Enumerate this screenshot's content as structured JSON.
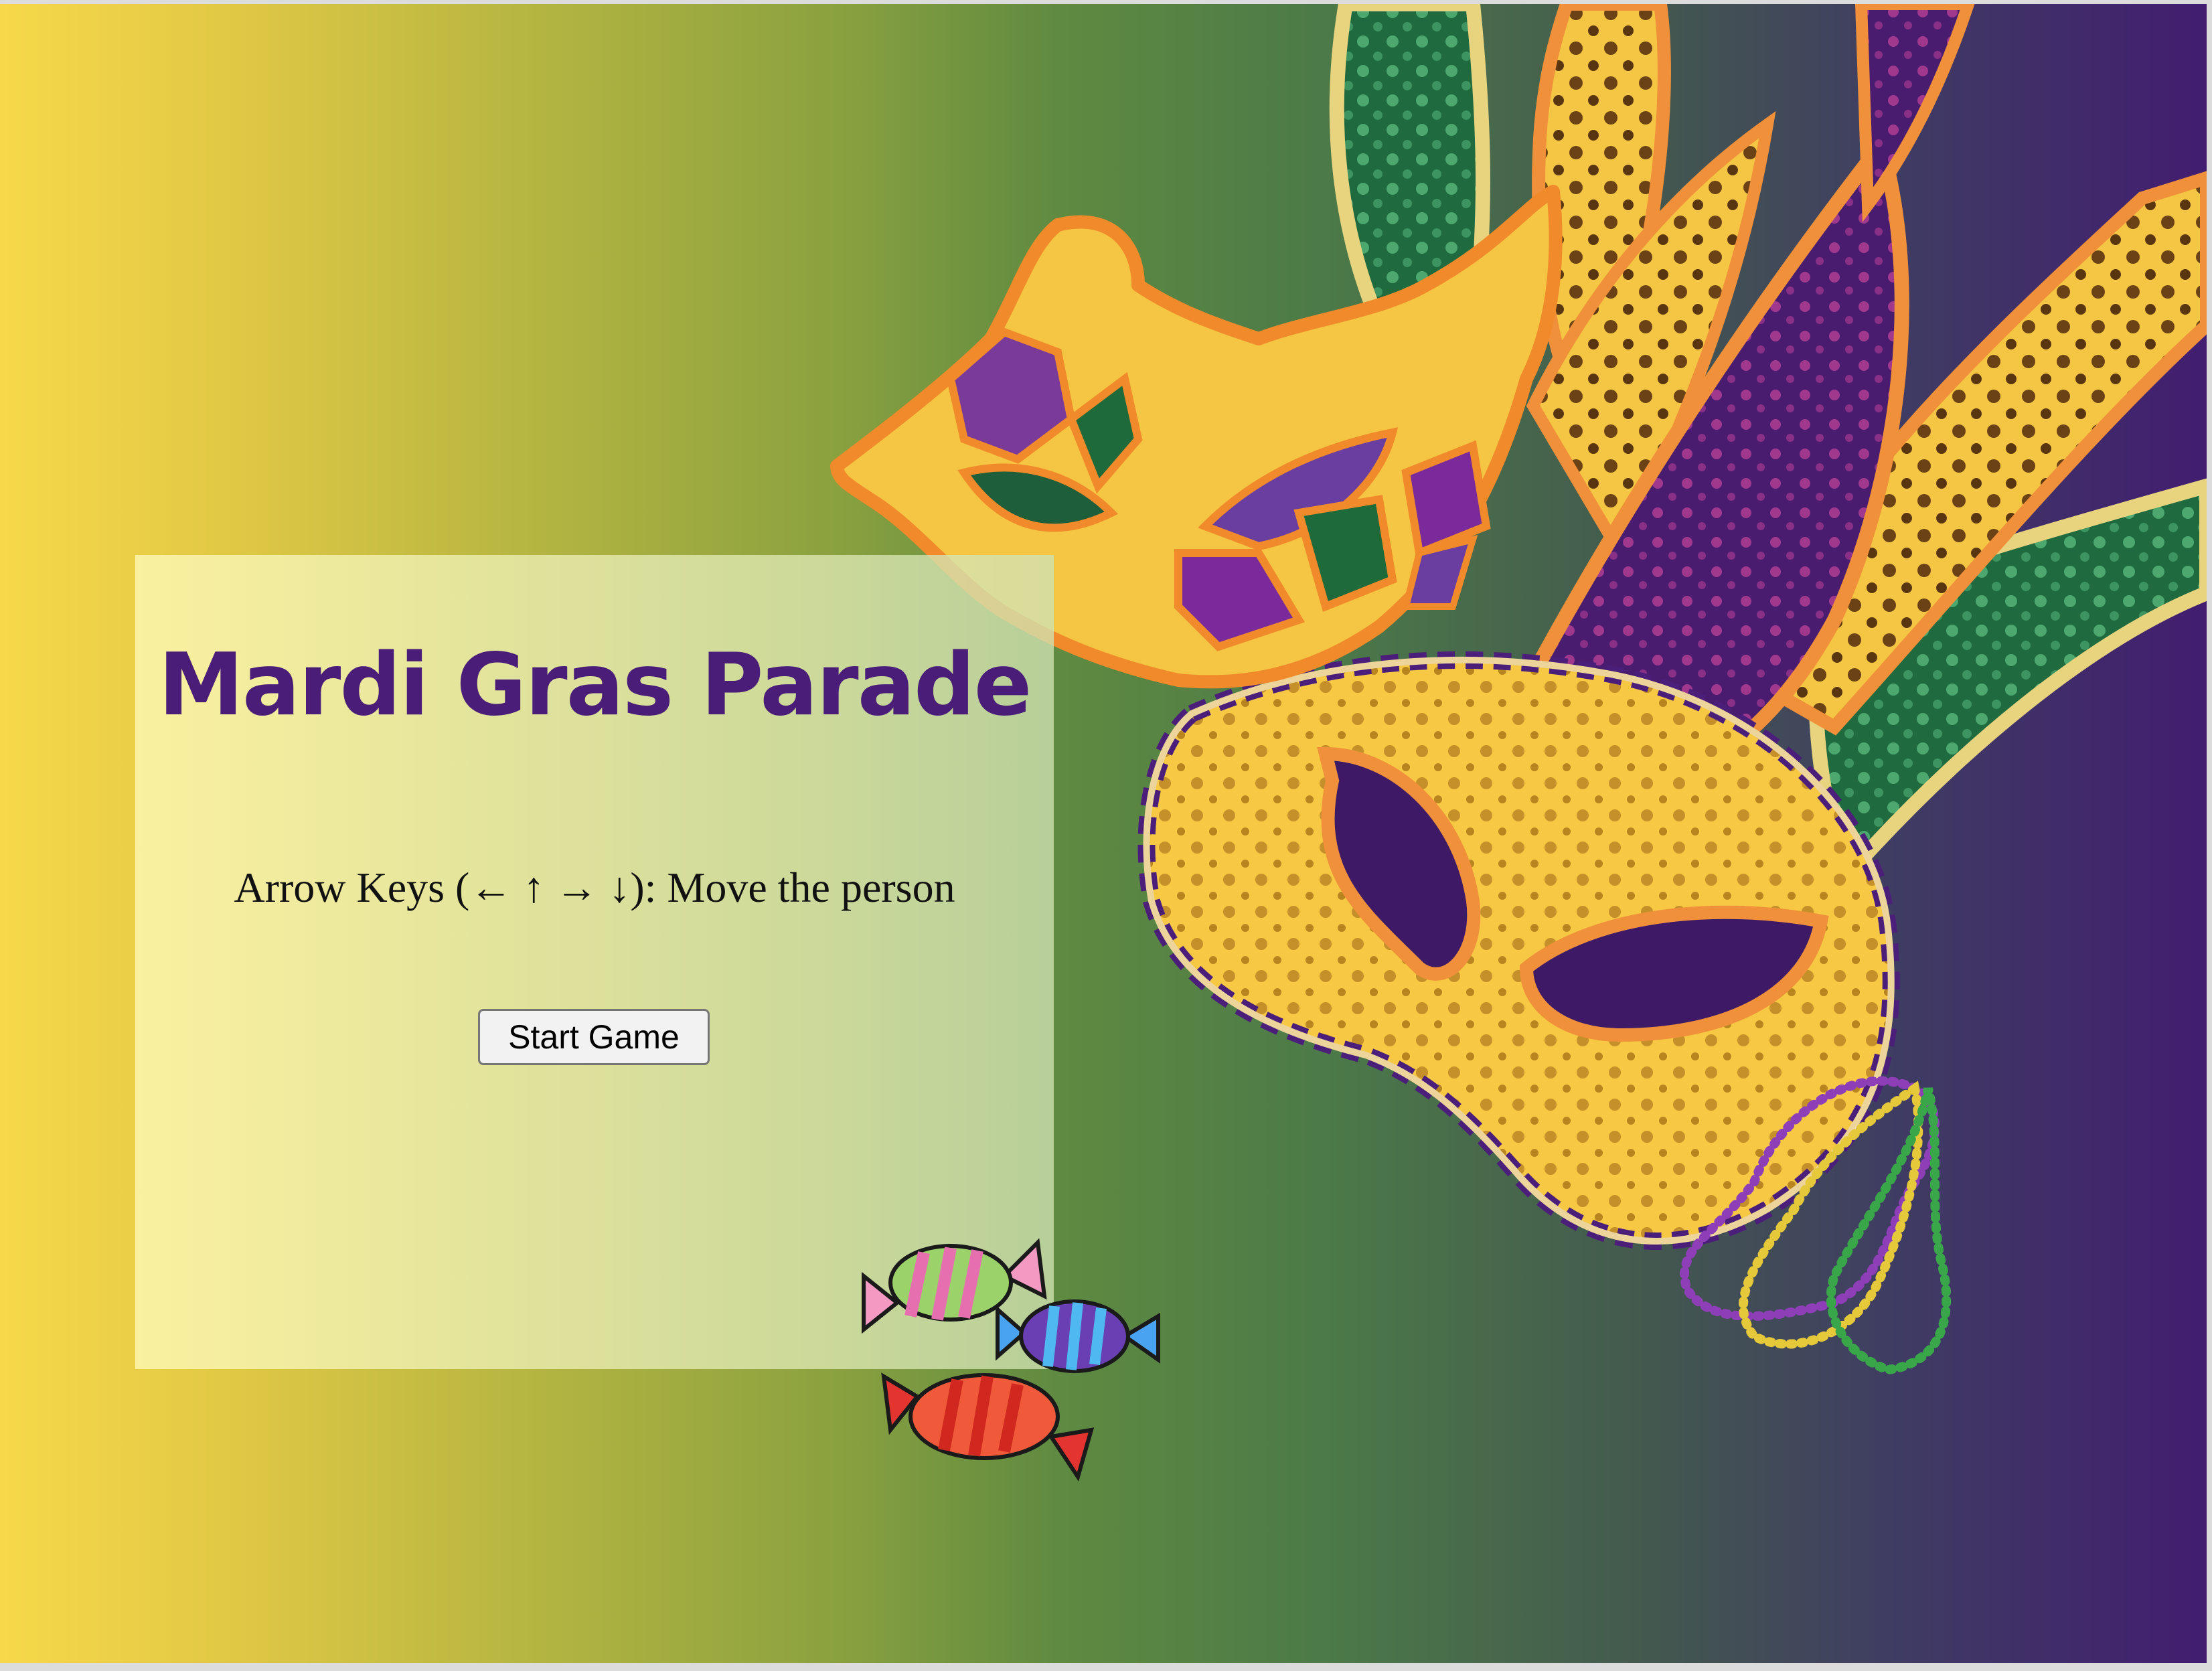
{
  "game": {
    "title": "Mardi Gras Parade",
    "instructions": "Arrow Keys (← ↑ → ↓): Move the person",
    "start_button_label": "Start Game"
  },
  "decorations": {
    "icons": [
      "feather-green-icon",
      "feather-gold-icon",
      "feather-purple-icon",
      "carnival-mask-small-icon",
      "carnival-mask-large-icon",
      "bead-necklace-icon",
      "candy-icon"
    ]
  },
  "colors": {
    "background_left": "#f7d84a",
    "background_mid": "#5f8a41",
    "background_right": "#421d70",
    "title": "#4a1e78",
    "mask_gold": "#f5c643",
    "mask_orange": "#f08a2a",
    "mask_purple": "#7a2a9a",
    "mask_green": "#1f6a3a"
  }
}
